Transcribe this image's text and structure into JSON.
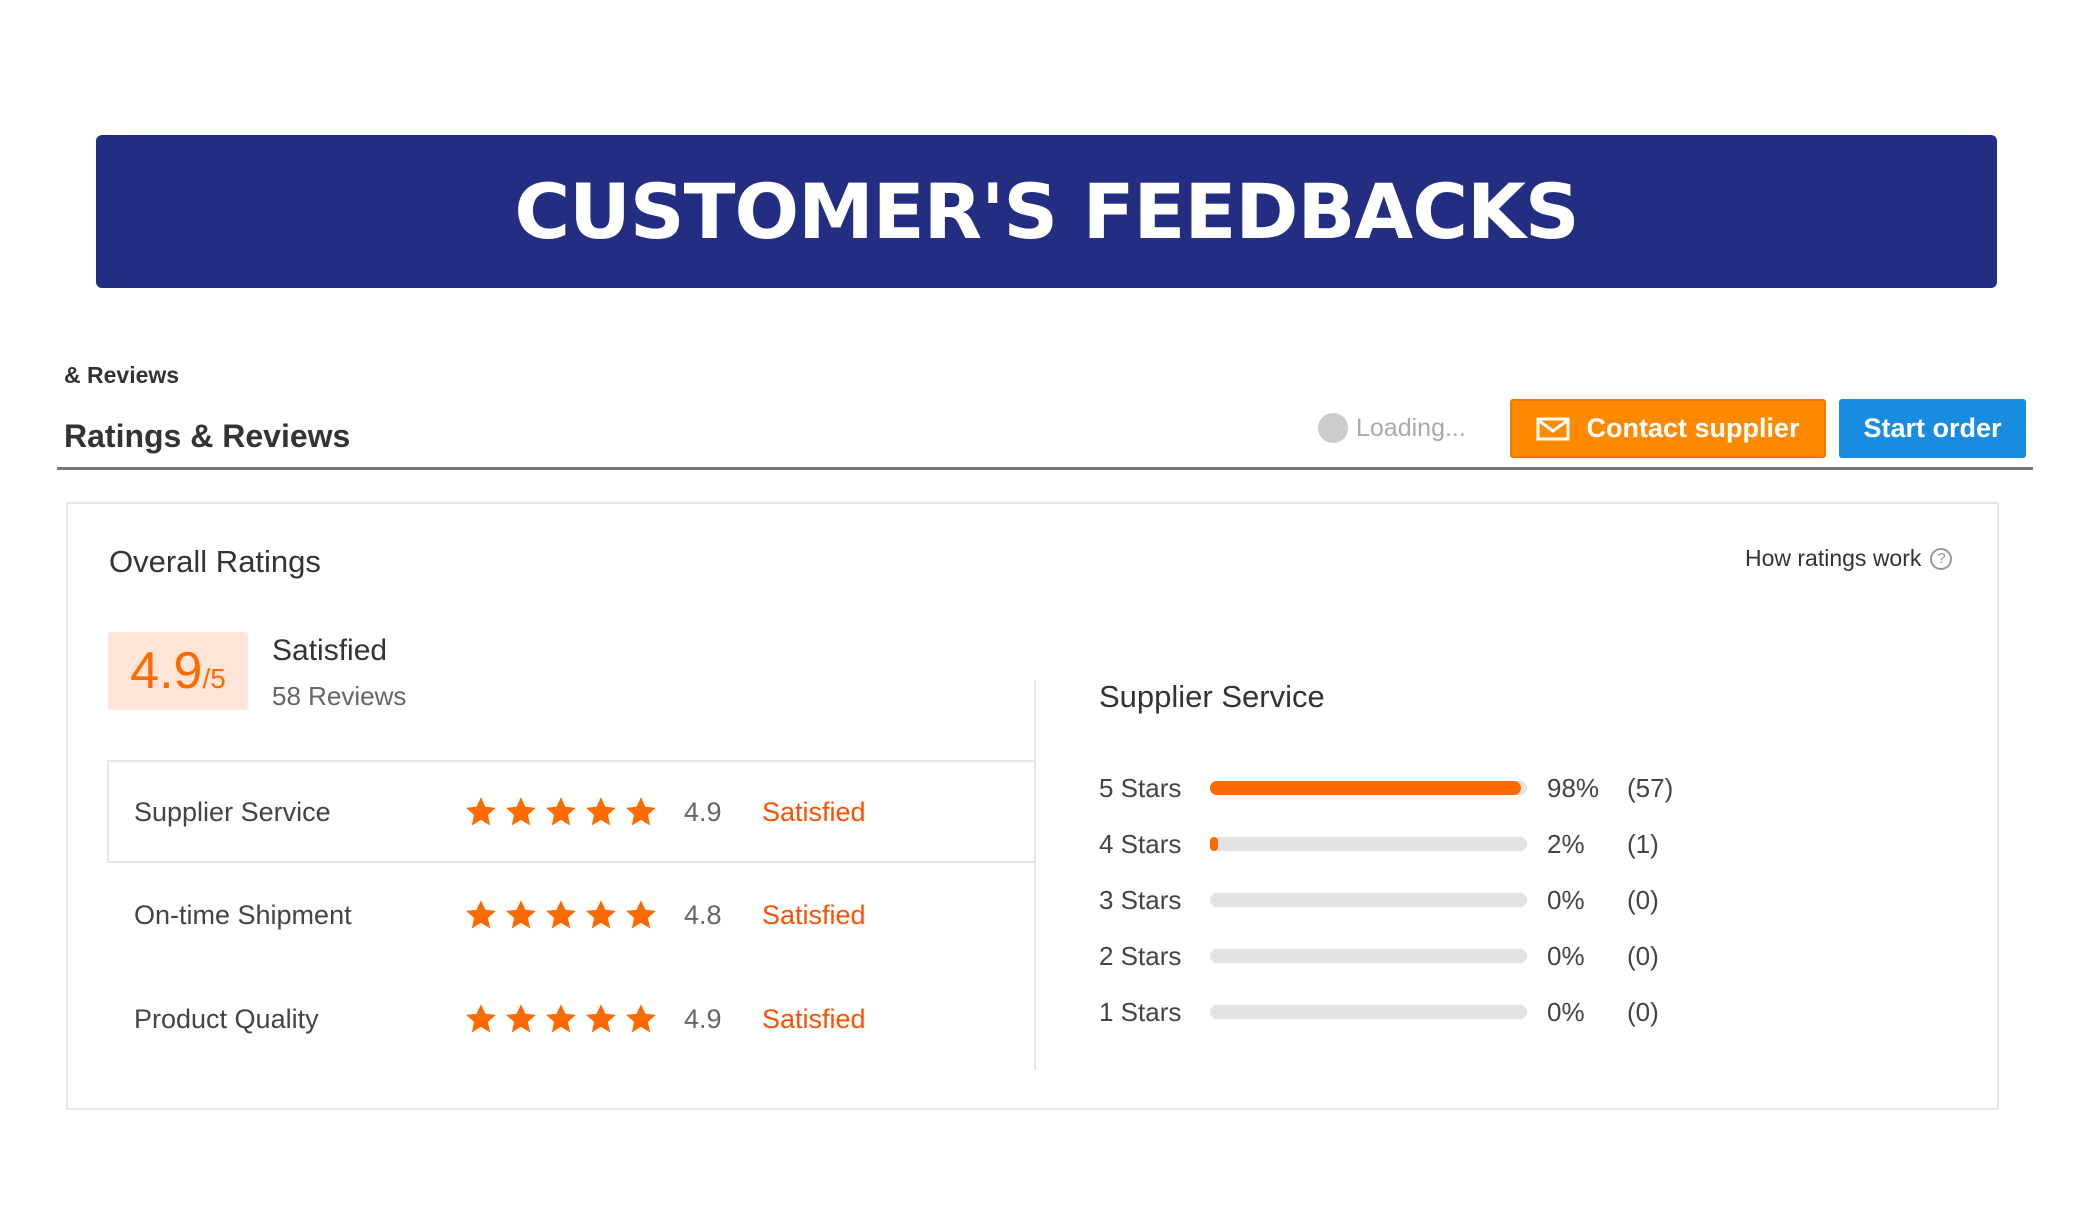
{
  "banner": {
    "title": "CUSTOMER'S FEEDBACKS"
  },
  "header": {
    "breadcrumb": "& Reviews",
    "title": "Ratings & Reviews",
    "loading_text": "Loading...",
    "contact_label": "Contact supplier",
    "start_label": "Start order"
  },
  "overall": {
    "title": "Overall Ratings",
    "how_link": "How ratings work",
    "help_glyph": "?",
    "score": "4.9",
    "score_suffix": "/5",
    "label": "Satisfied",
    "reviews": "58 Reviews"
  },
  "categories": [
    {
      "label": "Supplier Service",
      "rating": 4.9,
      "value": "4.9",
      "status": "Satisfied"
    },
    {
      "label": "On-time Shipment",
      "rating": 4.8,
      "value": "4.8",
      "status": "Satisfied"
    },
    {
      "label": "Product Quality",
      "rating": 4.9,
      "value": "4.9",
      "status": "Satisfied"
    }
  ],
  "supplier_service": {
    "title": "Supplier Service",
    "distribution": [
      {
        "label": "5  Stars",
        "fraction": 0.98,
        "pct": "98%",
        "count": "(57)"
      },
      {
        "label": "4  Stars",
        "fraction": 0.02,
        "pct": "2%",
        "count": "(1)"
      },
      {
        "label": "3  Stars",
        "fraction": 0,
        "pct": "0%",
        "count": "(0)"
      },
      {
        "label": "2  Stars",
        "fraction": 0,
        "pct": "0%",
        "count": "(0)"
      },
      {
        "label": "1  Stars",
        "fraction": 0,
        "pct": "0%",
        "count": "(0)"
      }
    ]
  },
  "colors": {
    "banner": "#232e82",
    "accent": "#ff6a00",
    "contact": "#ff8a00",
    "start": "#1a8ce0"
  },
  "icons": {
    "contact": "mail-icon",
    "loading": "spinner-icon",
    "help": "question-circle-icon",
    "star": "star-icon"
  }
}
